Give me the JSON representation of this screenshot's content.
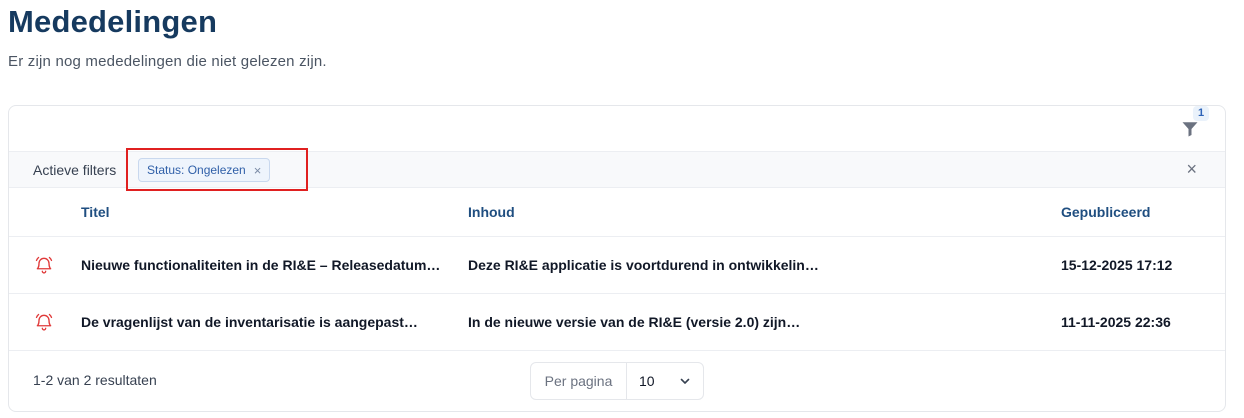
{
  "header": {
    "title": "Mededelingen",
    "subtitle": "Er zijn nog mededelingen die niet gelezen zijn."
  },
  "toolbar": {
    "filter_icon": "filter-icon",
    "filter_count": "1"
  },
  "filters": {
    "label": "Actieve filters",
    "chips": [
      {
        "label": "Status: Ongelezen",
        "close": "×"
      }
    ],
    "clear": "×"
  },
  "table": {
    "columns": [
      "Titel",
      "Inhoud",
      "Gepubliceerd"
    ],
    "rows": [
      {
        "icon": "bell-icon",
        "title": "Nieuwe functionaliteiten in de RI&E – Releasedatum…",
        "content": "Deze RI&E applicatie is voortdurend in ontwikkelin…",
        "published": "15-12-2025 17:12"
      },
      {
        "icon": "bell-icon",
        "title": "De vragenlijst van de inventarisatie is aangepast…",
        "content": "In de nieuwe versie van de RI&E (versie 2.0) zijn…",
        "published": "11-11-2025 22:36"
      }
    ]
  },
  "footer": {
    "results": "1-2 van 2 resultaten",
    "per_page_label": "Per pagina",
    "per_page_value": "10"
  },
  "colors": {
    "title": "#163a5f",
    "accent": "#2f64b8",
    "bell": "#e03a3a",
    "highlight": "#e02020"
  }
}
